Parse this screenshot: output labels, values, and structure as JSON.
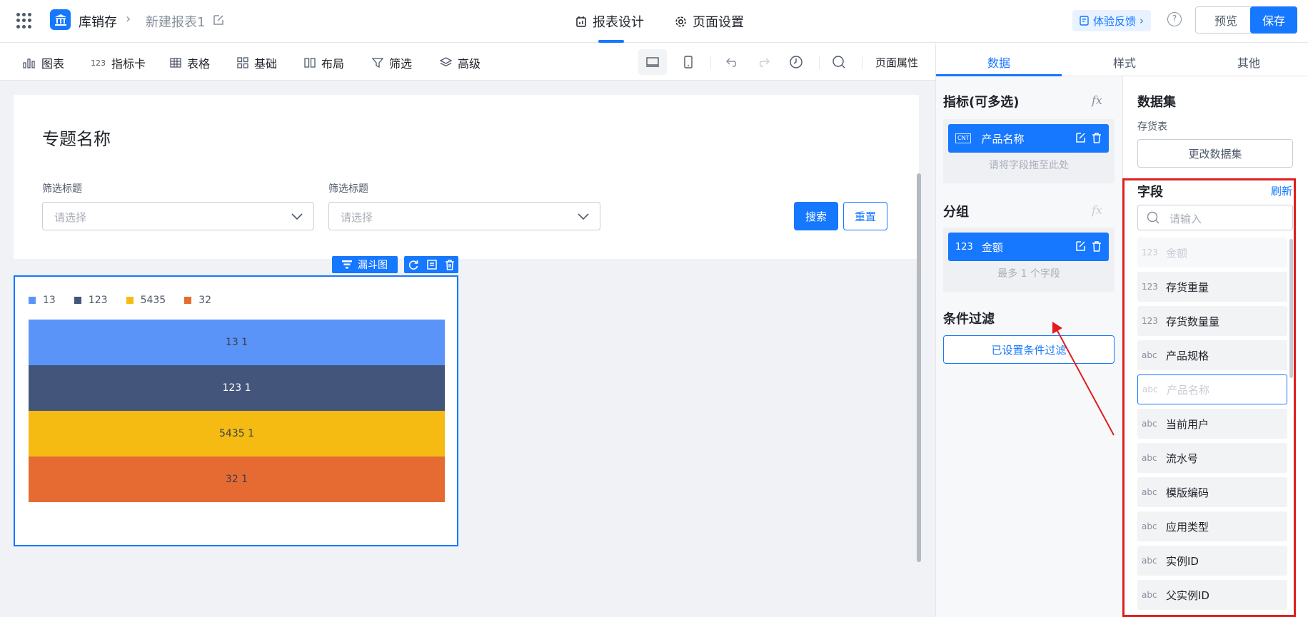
{
  "header": {
    "app_name": "库销存",
    "report_name": "新建报表1",
    "tabs": [
      {
        "label": "报表设计"
      },
      {
        "label": "页面设置"
      }
    ],
    "feedback_label": "体验反馈",
    "help_label": "?",
    "preview_label": "预览",
    "save_label": "保存"
  },
  "toolbar": {
    "items": [
      {
        "label": "图表",
        "icon": "bar-chart-icon"
      },
      {
        "label": "指标卡",
        "icon": "metric-card-icon",
        "icon_text": "123"
      },
      {
        "label": "表格",
        "icon": "table-icon"
      },
      {
        "label": "基础",
        "icon": "grid-icon"
      },
      {
        "label": "布局",
        "icon": "layout-icon"
      },
      {
        "label": "筛选",
        "icon": "filter-icon"
      },
      {
        "label": "高级",
        "icon": "layers-icon"
      }
    ],
    "page_props_label": "页面属性"
  },
  "canvas": {
    "page_title": "专题名称",
    "filters": [
      {
        "label": "筛选标题",
        "placeholder": "请选择"
      },
      {
        "label": "筛选标题",
        "placeholder": "请选择"
      }
    ],
    "search_label": "搜索",
    "reset_label": "重置",
    "chart_widget_label": "漏斗图"
  },
  "chart_data": {
    "type": "funnel",
    "legend": [
      "13",
      "123",
      "5435",
      "32"
    ],
    "segments": [
      {
        "name": "13",
        "value": 1,
        "label": "13 1",
        "color": "#5b94f8"
      },
      {
        "name": "123",
        "value": 1,
        "label": "123 1",
        "color": "#43557a"
      },
      {
        "name": "5435",
        "value": 1,
        "label": "5435 1",
        "color": "#f5bb12"
      },
      {
        "name": "32",
        "value": 1,
        "label": "32 1",
        "color": "#e66b33"
      }
    ]
  },
  "right_panel": {
    "tabs": [
      {
        "label": "数据"
      },
      {
        "label": "样式"
      },
      {
        "label": "其他"
      }
    ],
    "metrics": {
      "title": "指标(可多选)",
      "fx": "fx",
      "chip_label": "产品名称",
      "chip_tag": "CNT",
      "hint": "请将字段拖至此处"
    },
    "group": {
      "title": "分组",
      "fx": "fx",
      "chip_label": "金额",
      "chip_tag": "123",
      "hint": "最多 1 个字段"
    },
    "condition": {
      "title": "条件过滤",
      "button_label": "已设置条件过滤"
    },
    "dataset": {
      "title": "数据集",
      "name": "存货表",
      "change_label": "更改数据集"
    },
    "fields": {
      "title": "字段",
      "refresh_label": "刷新",
      "search_placeholder": "请输入",
      "items": [
        {
          "type": "123",
          "label": "金额",
          "state": "disabled"
        },
        {
          "type": "123",
          "label": "存货重量",
          "state": "normal"
        },
        {
          "type": "123",
          "label": "存货数量量",
          "state": "normal"
        },
        {
          "type": "abc",
          "label": "产品规格",
          "state": "normal"
        },
        {
          "type": "abc",
          "label": "产品名称",
          "state": "outlined"
        },
        {
          "type": "abc",
          "label": "当前用户",
          "state": "normal"
        },
        {
          "type": "abc",
          "label": "流水号",
          "state": "normal"
        },
        {
          "type": "abc",
          "label": "模版编码",
          "state": "normal"
        },
        {
          "type": "abc",
          "label": "应用类型",
          "state": "normal"
        },
        {
          "type": "abc",
          "label": "实例ID",
          "state": "normal"
        },
        {
          "type": "abc",
          "label": "父实例ID",
          "state": "normal"
        }
      ]
    }
  },
  "colors": {
    "accent": "#1677ff",
    "annotation_red": "#e01e1e"
  }
}
